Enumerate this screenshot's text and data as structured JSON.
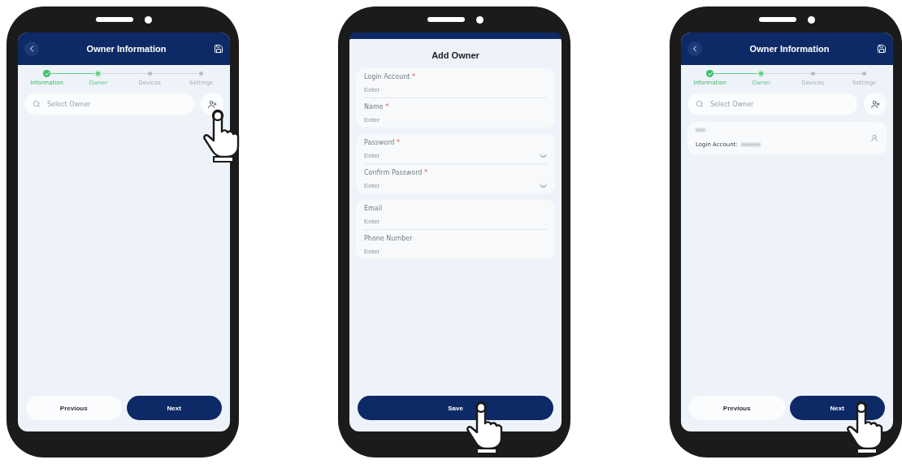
{
  "phones": [
    {
      "kind": "owner-info",
      "title": "Owner Information",
      "steps": [
        {
          "label": "Information",
          "completed": true,
          "selected": false
        },
        {
          "label": "Owner",
          "completed": false,
          "selected": true
        },
        {
          "label": "Devices",
          "completed": false,
          "selected": false
        },
        {
          "label": "Settings",
          "completed": false,
          "selected": false
        }
      ],
      "search": {
        "placeholder": "Select Owner",
        "pointed": true
      },
      "buttons": [
        {
          "label": "Previous",
          "kind": "secondary",
          "pointed": false
        },
        {
          "label": "Next",
          "kind": "primary",
          "pointed": false
        }
      ]
    },
    {
      "kind": "add-owner",
      "title": "Add Owner",
      "groups": [
        [
          {
            "label": "Login Account",
            "marker": "*",
            "placeholder": "Enter",
            "kind": "text"
          },
          {
            "label": "Name",
            "marker": "*",
            "placeholder": "Enter",
            "kind": "text"
          }
        ],
        [
          {
            "label": "Password",
            "marker": "*",
            "placeholder": "Enter",
            "kind": "password"
          },
          {
            "label": "Confirm Password",
            "marker": "*",
            "placeholder": "Enter",
            "kind": "password"
          }
        ],
        [
          {
            "label": "Email",
            "placeholder": "Enter",
            "kind": "text"
          },
          {
            "label": "Phone Number",
            "placeholder": "Enter",
            "kind": "text"
          }
        ]
      ],
      "buttons": [
        {
          "label": "Save",
          "kind": "primary",
          "pointed": true
        }
      ]
    },
    {
      "kind": "owner-info",
      "title": "Owner Information",
      "steps": [
        {
          "label": "Information",
          "completed": true,
          "selected": false
        },
        {
          "label": "Owner",
          "completed": false,
          "selected": true
        },
        {
          "label": "Devices",
          "completed": false,
          "selected": false
        },
        {
          "label": "Settings",
          "completed": false,
          "selected": false
        }
      ],
      "search": {
        "placeholder": "Select Owner",
        "pointed": false
      },
      "owners": [
        {
          "account_label": "Login Account:"
        }
      ],
      "buttons": [
        {
          "label": "Previous",
          "kind": "secondary",
          "pointed": false
        },
        {
          "label": "Next",
          "kind": "primary",
          "pointed": true
        }
      ]
    }
  ]
}
